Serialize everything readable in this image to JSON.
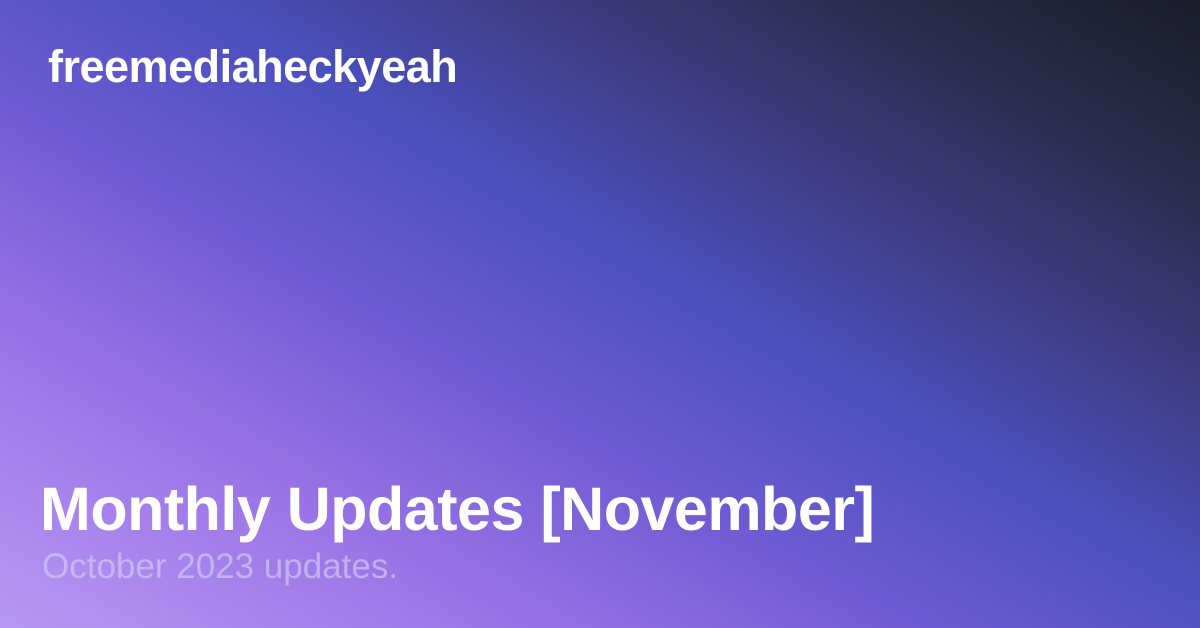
{
  "site": {
    "name": "freemediaheckyeah"
  },
  "post": {
    "title": "Monthly Updates [November]",
    "excerpt": "October 2023 updates."
  },
  "colors": {
    "gradient_start": "#b898f4",
    "gradient_mid": "#4a50bd",
    "gradient_end": "#1a1d2b",
    "text": "#ffffff"
  }
}
